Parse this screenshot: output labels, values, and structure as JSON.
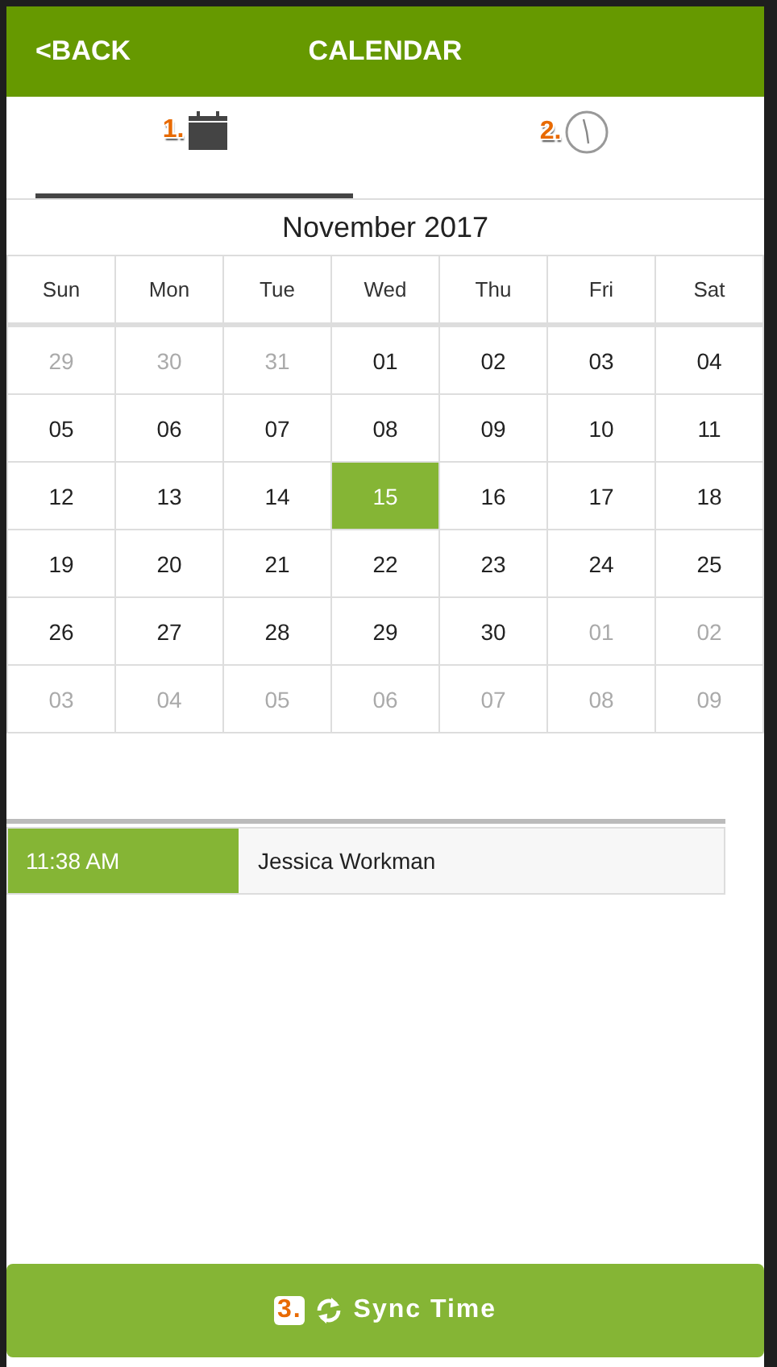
{
  "header": {
    "back": "<BACK",
    "title": "CALENDAR"
  },
  "tabs": [
    {
      "kind": "calendar",
      "marker": "1.",
      "selected": true
    },
    {
      "kind": "clock",
      "marker": "2.",
      "selected": false
    }
  ],
  "calendar": {
    "month": "November 2017",
    "weekdays": [
      "Sun",
      "Mon",
      "Tue",
      "Wed",
      "Thu",
      "Fri",
      "Sat"
    ],
    "weeks": [
      [
        {
          "day": "29",
          "outside": true,
          "selected": false
        },
        {
          "day": "30",
          "outside": true,
          "selected": false
        },
        {
          "day": "31",
          "outside": true,
          "selected": false
        },
        {
          "day": "01",
          "outside": false,
          "selected": false
        },
        {
          "day": "02",
          "outside": false,
          "selected": false
        },
        {
          "day": "03",
          "outside": false,
          "selected": false
        },
        {
          "day": "04",
          "outside": false,
          "selected": false
        }
      ],
      [
        {
          "day": "05",
          "outside": false,
          "selected": false
        },
        {
          "day": "06",
          "outside": false,
          "selected": false
        },
        {
          "day": "07",
          "outside": false,
          "selected": false
        },
        {
          "day": "08",
          "outside": false,
          "selected": false
        },
        {
          "day": "09",
          "outside": false,
          "selected": false
        },
        {
          "day": "10",
          "outside": false,
          "selected": false
        },
        {
          "day": "11",
          "outside": false,
          "selected": false
        }
      ],
      [
        {
          "day": "12",
          "outside": false,
          "selected": false
        },
        {
          "day": "13",
          "outside": false,
          "selected": false
        },
        {
          "day": "14",
          "outside": false,
          "selected": false
        },
        {
          "day": "15",
          "outside": false,
          "selected": true
        },
        {
          "day": "16",
          "outside": false,
          "selected": false
        },
        {
          "day": "17",
          "outside": false,
          "selected": false
        },
        {
          "day": "18",
          "outside": false,
          "selected": false
        }
      ],
      [
        {
          "day": "19",
          "outside": false,
          "selected": false
        },
        {
          "day": "20",
          "outside": false,
          "selected": false
        },
        {
          "day": "21",
          "outside": false,
          "selected": false
        },
        {
          "day": "22",
          "outside": false,
          "selected": false
        },
        {
          "day": "23",
          "outside": false,
          "selected": false
        },
        {
          "day": "24",
          "outside": false,
          "selected": false
        },
        {
          "day": "25",
          "outside": false,
          "selected": false
        }
      ],
      [
        {
          "day": "26",
          "outside": false,
          "selected": false
        },
        {
          "day": "27",
          "outside": false,
          "selected": false
        },
        {
          "day": "28",
          "outside": false,
          "selected": false
        },
        {
          "day": "29",
          "outside": false,
          "selected": false
        },
        {
          "day": "30",
          "outside": false,
          "selected": false
        },
        {
          "day": "01",
          "outside": true,
          "selected": false
        },
        {
          "day": "02",
          "outside": true,
          "selected": false
        }
      ],
      [
        {
          "day": "03",
          "outside": true,
          "selected": false
        },
        {
          "day": "04",
          "outside": true,
          "selected": false
        },
        {
          "day": "05",
          "outside": true,
          "selected": false
        },
        {
          "day": "06",
          "outside": true,
          "selected": false
        },
        {
          "day": "07",
          "outside": true,
          "selected": false
        },
        {
          "day": "08",
          "outside": true,
          "selected": false
        },
        {
          "day": "09",
          "outside": true,
          "selected": false
        }
      ]
    ]
  },
  "entries": [
    {
      "time": "11:38 AM",
      "name": "Jessica Workman"
    }
  ],
  "sync_button": {
    "marker": "3.",
    "label": "Sync Time"
  }
}
